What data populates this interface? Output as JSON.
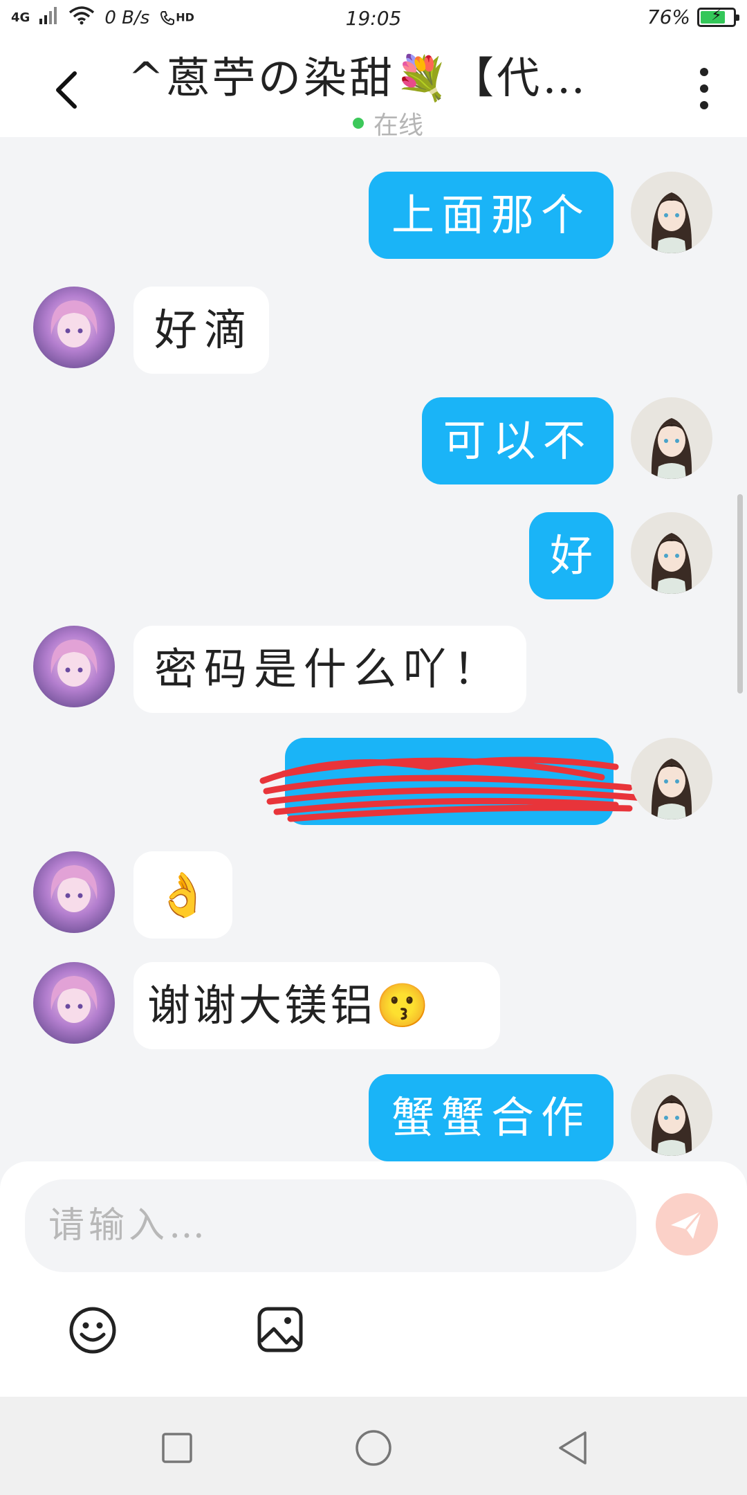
{
  "status_bar": {
    "network": "4G",
    "speed": "0 B/s",
    "hd": "HD",
    "time": "19:05",
    "battery_percent": "76%",
    "battery_level": 0.76,
    "battery_color": "#34c759"
  },
  "header": {
    "title": "^蒽苧の染甜💐【代…",
    "status": "在线",
    "status_color": "#3cc85a"
  },
  "messages": [
    {
      "side": "out",
      "text": "上面那个"
    },
    {
      "side": "in",
      "text": "好滴"
    },
    {
      "side": "out",
      "text": "可以不"
    },
    {
      "side": "out",
      "text": "好"
    },
    {
      "side": "in",
      "text": "密码是什么吖！"
    },
    {
      "side": "out",
      "text": "",
      "redacted": true
    },
    {
      "side": "in",
      "text": "👌"
    },
    {
      "side": "in",
      "text": "谢谢大镁铝😗"
    },
    {
      "side": "out",
      "text": "蟹蟹合作"
    }
  ],
  "composer": {
    "placeholder": "请输入…",
    "send_icon": "send-icon",
    "emoji_icon": "smiley-icon",
    "image_icon": "image-icon"
  },
  "colors": {
    "outgoing_bubble": "#1ab4f7",
    "incoming_bubble": "#ffffff",
    "background": "#f3f4f6",
    "send_button": "#fbd1c8"
  }
}
